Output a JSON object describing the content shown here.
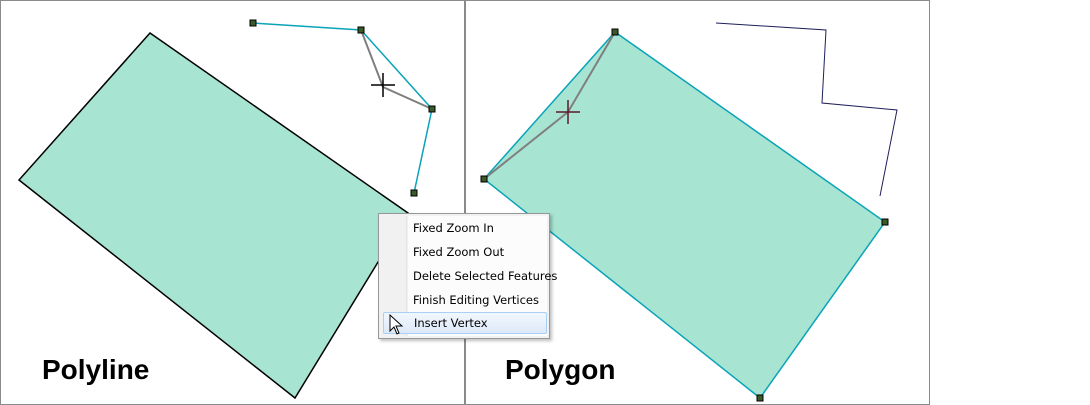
{
  "panels": {
    "left_label": "Polyline",
    "right_label": "Polygon"
  },
  "context_menu": {
    "items": [
      {
        "label": "Fixed Zoom In",
        "highlighted": false
      },
      {
        "label": "Fixed Zoom Out",
        "highlighted": false
      },
      {
        "label": "Delete Selected Features",
        "highlighted": false
      },
      {
        "label": "Finish Editing Vertices",
        "highlighted": false
      },
      {
        "label": "Insert Vertex",
        "highlighted": true
      }
    ]
  },
  "colors": {
    "polygon_fill": "#a8e4d2",
    "polyline_edit": "#0aa3b8",
    "rubberband": "#7f7f7f",
    "vertex_fill": "#3a5a2a",
    "menu_highlight_border": "#a8d0f5"
  },
  "icons": {
    "crosshair": "crosshair-cursor-icon",
    "pointer": "arrow-pointer-icon",
    "vertex": "vertex-handle-icon"
  }
}
